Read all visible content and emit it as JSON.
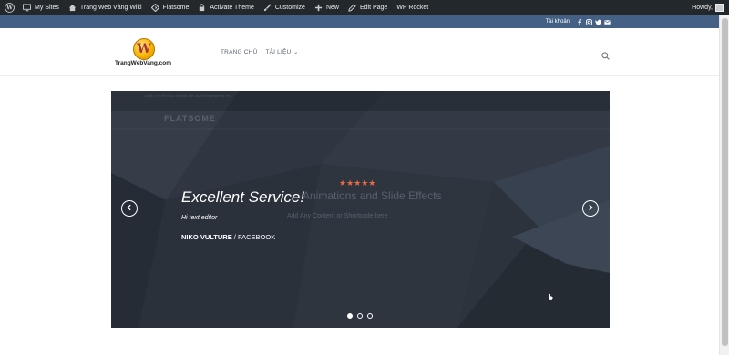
{
  "adminbar": {
    "items": [
      {
        "label": "My Sites",
        "icon": "my-sites-icon"
      },
      {
        "label": "Trang Web Vàng Wiki",
        "icon": "home-icon"
      },
      {
        "label": "Flatsome",
        "icon": "flatsome-icon"
      },
      {
        "label": "Activate Theme",
        "icon": "lock-icon"
      },
      {
        "label": "Customize",
        "icon": "brush-icon"
      },
      {
        "label": "New",
        "icon": "plus-icon"
      },
      {
        "label": "Edit Page",
        "icon": "pencil-icon"
      },
      {
        "label": "WP Rocket",
        "icon": ""
      }
    ],
    "howdy": "Howdy,"
  },
  "topbar": {
    "account": "Tài khoản",
    "social": [
      "facebook-icon",
      "instagram-icon",
      "twitter-icon",
      "email-icon"
    ]
  },
  "header": {
    "logo_text": "TrangWebVang.com",
    "logo_letter": "W",
    "nav": [
      "TRANG CHỦ",
      "TÀI LIỆU"
    ]
  },
  "slider": {
    "ghost_top": "ADD ANYTHING HERE OR JUST REMOVE IT...",
    "ghost_nav_logo": "FLATSOME",
    "ghost_title": "Animations and Slide Effects",
    "ghost_subtitle": "Add Any Content or Shortcode here",
    "stars": "★★★★★",
    "quote_title": "Excellent Service!",
    "quote_text": "Hi text editor",
    "author_name": "NIKO VULTURE",
    "author_source": " / FACEBOOK",
    "active_slide": 1,
    "slide_count": 3
  },
  "colors": {
    "adminbar": "#23282d",
    "topbar": "#446084",
    "slider_bg": "#2c333d",
    "stars": "#e86a45"
  }
}
